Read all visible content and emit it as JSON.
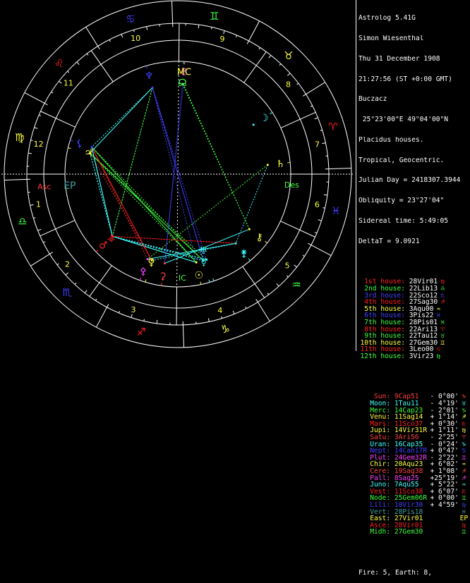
{
  "header": {
    "program": "Astrolog 5.41G",
    "name": "Simon Wiesenthal",
    "date": "Thu 31 December 1908",
    "time": "21:27:56 (ST +0:00 GMT)",
    "place": "Buczacz",
    "coords": " 25°23'00\"E 49°04'00\"N",
    "system": "Placidus houses.",
    "zodiac": "Tropical, Geocentric.",
    "julian": "Julian Day = 2418307.3944",
    "obliquity": "Obliquity = 23°27'04\"",
    "sidereal": "Sidereal time: 5:49:05",
    "delta": "DeltaT = 9.0921"
  },
  "houses": [
    {
      "label": "1st house:",
      "value": "28Vir01",
      "color": "#ff2020",
      "glyph": "♍"
    },
    {
      "label": "2nd house:",
      "value": "22Lib13",
      "color": "#40ff40",
      "glyph": "♎"
    },
    {
      "label": "3rd house:",
      "value": "22Sco12",
      "color": "#4040ff",
      "glyph": "♏"
    },
    {
      "label": "4th house:",
      "value": "27Sag30",
      "color": "#ff2020",
      "glyph": "♐"
    },
    {
      "label": "5th house:",
      "value": "3Aqu00",
      "color": "#ffff40",
      "glyph": "♒"
    },
    {
      "label": "6th house:",
      "value": "3Pis22",
      "color": "#4040ff",
      "glyph": "♓"
    },
    {
      "label": "7th house:",
      "value": "28Pis01",
      "color": "#40ff40",
      "glyph": "♓"
    },
    {
      "label": "8th house:",
      "value": "22Ari13",
      "color": "#ff2020",
      "glyph": "♈"
    },
    {
      "label": "9th house:",
      "value": "22Tau12",
      "color": "#40ff40",
      "glyph": "♉"
    },
    {
      "label": "10th house:",
      "value": "27Gem30",
      "color": "#ffff40",
      "glyph": "♊"
    },
    {
      "label": "11th house:",
      "value": "3Leo00",
      "color": "#ff2020",
      "glyph": "♌"
    },
    {
      "label": "12th house:",
      "value": "3Vir23",
      "color": "#40ff40",
      "glyph": "♍"
    }
  ],
  "planets": [
    {
      "label": "Sun:",
      "value": "9Cap51",
      "deg": "- 0°00'",
      "color": "#ff4040",
      "glyph": "♑"
    },
    {
      "label": "Moon:",
      "value": "1Tau11",
      "deg": "- 4°19'",
      "color": "#40ffff",
      "glyph": "♉"
    },
    {
      "label": "Merc:",
      "value": "14Cap23",
      "deg": "- 2°01'",
      "color": "#40ff40",
      "glyph": "♑"
    },
    {
      "label": "Venu:",
      "value": "11Sag14",
      "deg": "+ 1°14'",
      "color": "#ffff40",
      "glyph": "♐"
    },
    {
      "label": "Mars:",
      "value": "11Sco37",
      "deg": "+ 0°30'",
      "color": "#ff2020",
      "glyph": "♏"
    },
    {
      "label": "Jupi:",
      "value": "14Vir31R",
      "deg": "+ 1°11'",
      "color": "#ffff40",
      "glyph": "♍"
    },
    {
      "label": "Satu:",
      "value": "3Ari56",
      "deg": "- 2°25'",
      "color": "#ff4040",
      "glyph": "♈"
    },
    {
      "label": "Uran:",
      "value": "16Cap35",
      "deg": "- 0°24'",
      "color": "#40ffff",
      "glyph": "♑"
    },
    {
      "label": "Nept:",
      "value": "14Can17R",
      "deg": "+ 0°47'",
      "color": "#4040ff",
      "glyph": "♋"
    },
    {
      "label": "Plut:",
      "value": "24Gem32R",
      "deg": "- 2°22'",
      "color": "#ff40ff",
      "glyph": "♊"
    },
    {
      "label": "Chir:",
      "value": "20Aqu23",
      "deg": "+ 6°02'",
      "color": "#ffff40",
      "glyph": "♒"
    },
    {
      "label": "Cere:",
      "value": "19Sag38",
      "deg": "+ 1°08'",
      "color": "#ff4040",
      "glyph": "♐"
    },
    {
      "label": "Pall:",
      "value": "8Sag25",
      "deg": "+25°19'",
      "color": "#ff40ff",
      "glyph": "♐"
    },
    {
      "label": "Juno:",
      "value": "7Aqu55",
      "deg": "+ 5°22'",
      "color": "#40ffff",
      "glyph": "♒"
    },
    {
      "label": "Vest:",
      "value": "11Sco38",
      "deg": "+ 6°07'",
      "color": "#ff2020",
      "glyph": "♏"
    },
    {
      "label": "Node:",
      "value": "25Gem06R",
      "deg": "+ 0°00'",
      "color": "#40ff40",
      "glyph": "♊"
    },
    {
      "label": "Lili:",
      "value": "10Vir30",
      "deg": "+ 4°59'",
      "color": "#4040ff",
      "glyph": "♍"
    },
    {
      "label": "Vert:",
      "value": "28Pis18",
      "deg": "",
      "color": "#40a0a0",
      "glyph": "♓"
    },
    {
      "label": "East:",
      "value": "27Vir01",
      "deg": "",
      "color": "#ffff40",
      "glyph": "EP"
    },
    {
      "label": "Asce:",
      "value": "28Vir01",
      "deg": "",
      "color": "#ff2020",
      "glyph": "♍"
    },
    {
      "label": "Midh:",
      "value": "27Gem30",
      "deg": "",
      "color": "#40ff40",
      "glyph": "♊"
    }
  ],
  "footer": "Fire: 5, Earth: 8,",
  "chart": {
    "house_numbers": [
      "1",
      "2",
      "3",
      "4",
      "5",
      "6",
      "7",
      "8",
      "9",
      "10",
      "11",
      "12"
    ],
    "axis_labels": {
      "asc": "Asc",
      "des": "Des",
      "mc": "MC",
      "ic": "IC",
      "ep": "EP"
    },
    "signs": [
      {
        "glyph": "♈",
        "color": "#ff2020"
      },
      {
        "glyph": "♉",
        "color": "#ffff40"
      },
      {
        "glyph": "♊",
        "color": "#40ff40"
      },
      {
        "glyph": "♋",
        "color": "#4040ff"
      },
      {
        "glyph": "♌",
        "color": "#ff2020"
      },
      {
        "glyph": "♍",
        "color": "#ffff40"
      },
      {
        "glyph": "♎",
        "color": "#40ff40"
      },
      {
        "glyph": "♏",
        "color": "#4040ff"
      },
      {
        "glyph": "♐",
        "color": "#ff2020"
      },
      {
        "glyph": "♑",
        "color": "#ffff40"
      },
      {
        "glyph": "♒",
        "color": "#40ff40"
      },
      {
        "glyph": "♓",
        "color": "#4040ff"
      }
    ],
    "ascendant_deg": 178.02,
    "house_cusps_deg": [
      178.02,
      202.22,
      232.2,
      267.5,
      303.0,
      333.37,
      358.02,
      22.22,
      52.2,
      87.5,
      123.0,
      153.37
    ],
    "planets_deg": [
      {
        "name": "sun",
        "glyph": "☉",
        "lon": 279.85,
        "color": "#ffff40"
      },
      {
        "name": "moon",
        "glyph": "☽",
        "lon": 31.18,
        "color": "#40ffff"
      },
      {
        "name": "mercury",
        "glyph": "☿",
        "lon": 284.38,
        "color": "#40ffff"
      },
      {
        "name": "venus",
        "glyph": "♀",
        "lon": 251.23,
        "color": "#ffff40"
      },
      {
        "name": "mars",
        "glyph": "♂",
        "lon": 221.62,
        "color": "#ff2020"
      },
      {
        "name": "jupiter",
        "glyph": "♃",
        "lon": 164.52,
        "color": "#ffff40"
      },
      {
        "name": "saturn",
        "glyph": "♄",
        "lon": 3.93,
        "color": "#ffff40"
      },
      {
        "name": "uranus",
        "glyph": "♅",
        "lon": 286.58,
        "color": "#40ffff"
      },
      {
        "name": "neptune",
        "glyph": "♆",
        "lon": 104.28,
        "color": "#4040ff"
      },
      {
        "name": "pluto",
        "glyph": "♇",
        "lon": 84.53,
        "color": "#ff40ff"
      },
      {
        "name": "chiron",
        "glyph": "⚷",
        "lon": 320.38,
        "color": "#ffff40"
      },
      {
        "name": "ceres",
        "glyph": "⚳",
        "lon": 259.63,
        "color": "#ff4040"
      },
      {
        "name": "pallas",
        "glyph": "⚴",
        "lon": 248.42,
        "color": "#ff40ff"
      },
      {
        "name": "juno",
        "glyph": "⚵",
        "lon": 307.92,
        "color": "#40ffff"
      },
      {
        "name": "vesta",
        "glyph": "⚶",
        "lon": 221.63,
        "color": "#ff2020"
      },
      {
        "name": "node",
        "glyph": "☊",
        "lon": 85.1,
        "color": "#40ff40"
      },
      {
        "name": "lilith",
        "glyph": "⚸",
        "lon": 160.5,
        "color": "#4040ff"
      }
    ]
  }
}
